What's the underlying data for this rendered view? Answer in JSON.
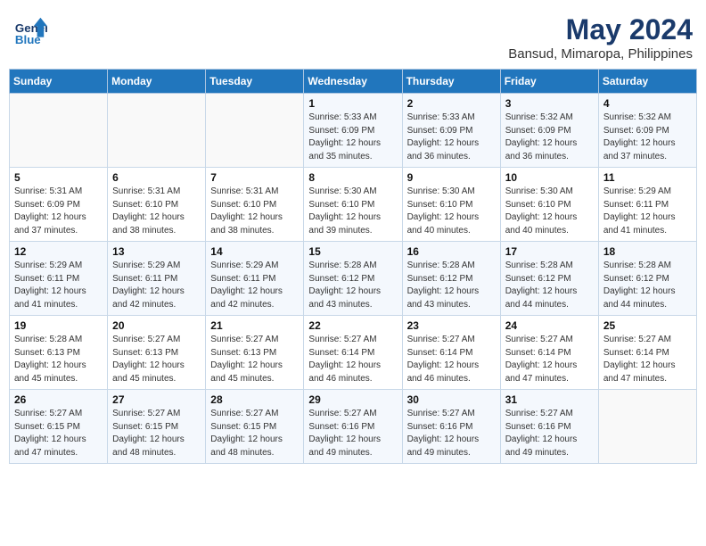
{
  "header": {
    "logo_general": "General",
    "logo_blue": "Blue",
    "month_year": "May 2024",
    "location": "Bansud, Mimaropa, Philippines"
  },
  "weekdays": [
    "Sunday",
    "Monday",
    "Tuesday",
    "Wednesday",
    "Thursday",
    "Friday",
    "Saturday"
  ],
  "weeks": [
    [
      {
        "day": "",
        "sunrise": "",
        "sunset": "",
        "daylight": ""
      },
      {
        "day": "",
        "sunrise": "",
        "sunset": "",
        "daylight": ""
      },
      {
        "day": "",
        "sunrise": "",
        "sunset": "",
        "daylight": ""
      },
      {
        "day": "1",
        "sunrise": "Sunrise: 5:33 AM",
        "sunset": "Sunset: 6:09 PM",
        "daylight": "Daylight: 12 hours and 35 minutes."
      },
      {
        "day": "2",
        "sunrise": "Sunrise: 5:33 AM",
        "sunset": "Sunset: 6:09 PM",
        "daylight": "Daylight: 12 hours and 36 minutes."
      },
      {
        "day": "3",
        "sunrise": "Sunrise: 5:32 AM",
        "sunset": "Sunset: 6:09 PM",
        "daylight": "Daylight: 12 hours and 36 minutes."
      },
      {
        "day": "4",
        "sunrise": "Sunrise: 5:32 AM",
        "sunset": "Sunset: 6:09 PM",
        "daylight": "Daylight: 12 hours and 37 minutes."
      }
    ],
    [
      {
        "day": "5",
        "sunrise": "Sunrise: 5:31 AM",
        "sunset": "Sunset: 6:09 PM",
        "daylight": "Daylight: 12 hours and 37 minutes."
      },
      {
        "day": "6",
        "sunrise": "Sunrise: 5:31 AM",
        "sunset": "Sunset: 6:10 PM",
        "daylight": "Daylight: 12 hours and 38 minutes."
      },
      {
        "day": "7",
        "sunrise": "Sunrise: 5:31 AM",
        "sunset": "Sunset: 6:10 PM",
        "daylight": "Daylight: 12 hours and 38 minutes."
      },
      {
        "day": "8",
        "sunrise": "Sunrise: 5:30 AM",
        "sunset": "Sunset: 6:10 PM",
        "daylight": "Daylight: 12 hours and 39 minutes."
      },
      {
        "day": "9",
        "sunrise": "Sunrise: 5:30 AM",
        "sunset": "Sunset: 6:10 PM",
        "daylight": "Daylight: 12 hours and 40 minutes."
      },
      {
        "day": "10",
        "sunrise": "Sunrise: 5:30 AM",
        "sunset": "Sunset: 6:10 PM",
        "daylight": "Daylight: 12 hours and 40 minutes."
      },
      {
        "day": "11",
        "sunrise": "Sunrise: 5:29 AM",
        "sunset": "Sunset: 6:11 PM",
        "daylight": "Daylight: 12 hours and 41 minutes."
      }
    ],
    [
      {
        "day": "12",
        "sunrise": "Sunrise: 5:29 AM",
        "sunset": "Sunset: 6:11 PM",
        "daylight": "Daylight: 12 hours and 41 minutes."
      },
      {
        "day": "13",
        "sunrise": "Sunrise: 5:29 AM",
        "sunset": "Sunset: 6:11 PM",
        "daylight": "Daylight: 12 hours and 42 minutes."
      },
      {
        "day": "14",
        "sunrise": "Sunrise: 5:29 AM",
        "sunset": "Sunset: 6:11 PM",
        "daylight": "Daylight: 12 hours and 42 minutes."
      },
      {
        "day": "15",
        "sunrise": "Sunrise: 5:28 AM",
        "sunset": "Sunset: 6:12 PM",
        "daylight": "Daylight: 12 hours and 43 minutes."
      },
      {
        "day": "16",
        "sunrise": "Sunrise: 5:28 AM",
        "sunset": "Sunset: 6:12 PM",
        "daylight": "Daylight: 12 hours and 43 minutes."
      },
      {
        "day": "17",
        "sunrise": "Sunrise: 5:28 AM",
        "sunset": "Sunset: 6:12 PM",
        "daylight": "Daylight: 12 hours and 44 minutes."
      },
      {
        "day": "18",
        "sunrise": "Sunrise: 5:28 AM",
        "sunset": "Sunset: 6:12 PM",
        "daylight": "Daylight: 12 hours and 44 minutes."
      }
    ],
    [
      {
        "day": "19",
        "sunrise": "Sunrise: 5:28 AM",
        "sunset": "Sunset: 6:13 PM",
        "daylight": "Daylight: 12 hours and 45 minutes."
      },
      {
        "day": "20",
        "sunrise": "Sunrise: 5:27 AM",
        "sunset": "Sunset: 6:13 PM",
        "daylight": "Daylight: 12 hours and 45 minutes."
      },
      {
        "day": "21",
        "sunrise": "Sunrise: 5:27 AM",
        "sunset": "Sunset: 6:13 PM",
        "daylight": "Daylight: 12 hours and 45 minutes."
      },
      {
        "day": "22",
        "sunrise": "Sunrise: 5:27 AM",
        "sunset": "Sunset: 6:14 PM",
        "daylight": "Daylight: 12 hours and 46 minutes."
      },
      {
        "day": "23",
        "sunrise": "Sunrise: 5:27 AM",
        "sunset": "Sunset: 6:14 PM",
        "daylight": "Daylight: 12 hours and 46 minutes."
      },
      {
        "day": "24",
        "sunrise": "Sunrise: 5:27 AM",
        "sunset": "Sunset: 6:14 PM",
        "daylight": "Daylight: 12 hours and 47 minutes."
      },
      {
        "day": "25",
        "sunrise": "Sunrise: 5:27 AM",
        "sunset": "Sunset: 6:14 PM",
        "daylight": "Daylight: 12 hours and 47 minutes."
      }
    ],
    [
      {
        "day": "26",
        "sunrise": "Sunrise: 5:27 AM",
        "sunset": "Sunset: 6:15 PM",
        "daylight": "Daylight: 12 hours and 47 minutes."
      },
      {
        "day": "27",
        "sunrise": "Sunrise: 5:27 AM",
        "sunset": "Sunset: 6:15 PM",
        "daylight": "Daylight: 12 hours and 48 minutes."
      },
      {
        "day": "28",
        "sunrise": "Sunrise: 5:27 AM",
        "sunset": "Sunset: 6:15 PM",
        "daylight": "Daylight: 12 hours and 48 minutes."
      },
      {
        "day": "29",
        "sunrise": "Sunrise: 5:27 AM",
        "sunset": "Sunset: 6:16 PM",
        "daylight": "Daylight: 12 hours and 49 minutes."
      },
      {
        "day": "30",
        "sunrise": "Sunrise: 5:27 AM",
        "sunset": "Sunset: 6:16 PM",
        "daylight": "Daylight: 12 hours and 49 minutes."
      },
      {
        "day": "31",
        "sunrise": "Sunrise: 5:27 AM",
        "sunset": "Sunset: 6:16 PM",
        "daylight": "Daylight: 12 hours and 49 minutes."
      },
      {
        "day": "",
        "sunrise": "",
        "sunset": "",
        "daylight": ""
      }
    ]
  ]
}
